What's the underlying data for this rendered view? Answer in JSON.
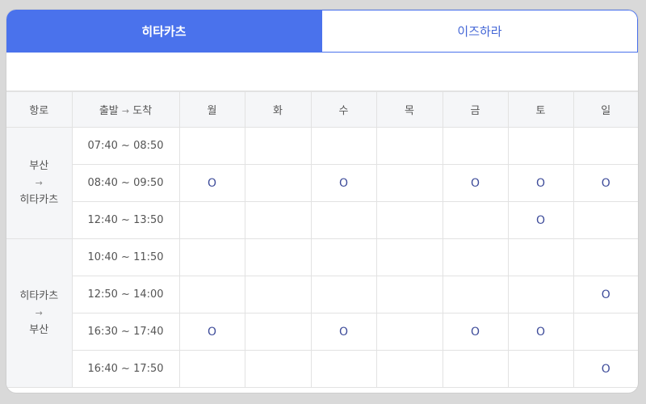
{
  "tabs": [
    {
      "label": "히타카츠",
      "active": true
    },
    {
      "label": "이즈하라",
      "active": false
    }
  ],
  "table": {
    "headers": {
      "route": "항로",
      "time_depart": "출발",
      "time_arrow": "→",
      "time_arrive": "도착",
      "days": [
        "월",
        "화",
        "수",
        "목",
        "금",
        "토",
        "일"
      ]
    },
    "routes": [
      {
        "from": "부산",
        "arrow": "→",
        "to": "히타카츠",
        "rows": [
          {
            "time": "07:40 ~ 08:50",
            "marks": [
              "",
              "",
              "",
              "",
              "",
              "",
              ""
            ]
          },
          {
            "time": "08:40 ~ 09:50",
            "marks": [
              "O",
              "",
              "O",
              "",
              "O",
              "O",
              "O"
            ]
          },
          {
            "time": "12:40 ~ 13:50",
            "marks": [
              "",
              "",
              "",
              "",
              "",
              "O",
              ""
            ]
          }
        ]
      },
      {
        "from": "히타카츠",
        "arrow": "→",
        "to": "부산",
        "rows": [
          {
            "time": "10:40 ~ 11:50",
            "marks": [
              "",
              "",
              "",
              "",
              "",
              "",
              ""
            ]
          },
          {
            "time": "12:50 ~ 14:00",
            "marks": [
              "",
              "",
              "",
              "",
              "",
              "",
              "O"
            ]
          },
          {
            "time": "16:30 ~ 17:40",
            "marks": [
              "O",
              "",
              "O",
              "",
              "O",
              "O",
              ""
            ]
          },
          {
            "time": "16:40 ~ 17:50",
            "marks": [
              "",
              "",
              "",
              "",
              "",
              "",
              "O"
            ]
          }
        ]
      }
    ]
  },
  "colors": {
    "active_tab": "#4a72ec",
    "mark": "#3e4c9a",
    "header_bg": "#f5f6f8"
  }
}
